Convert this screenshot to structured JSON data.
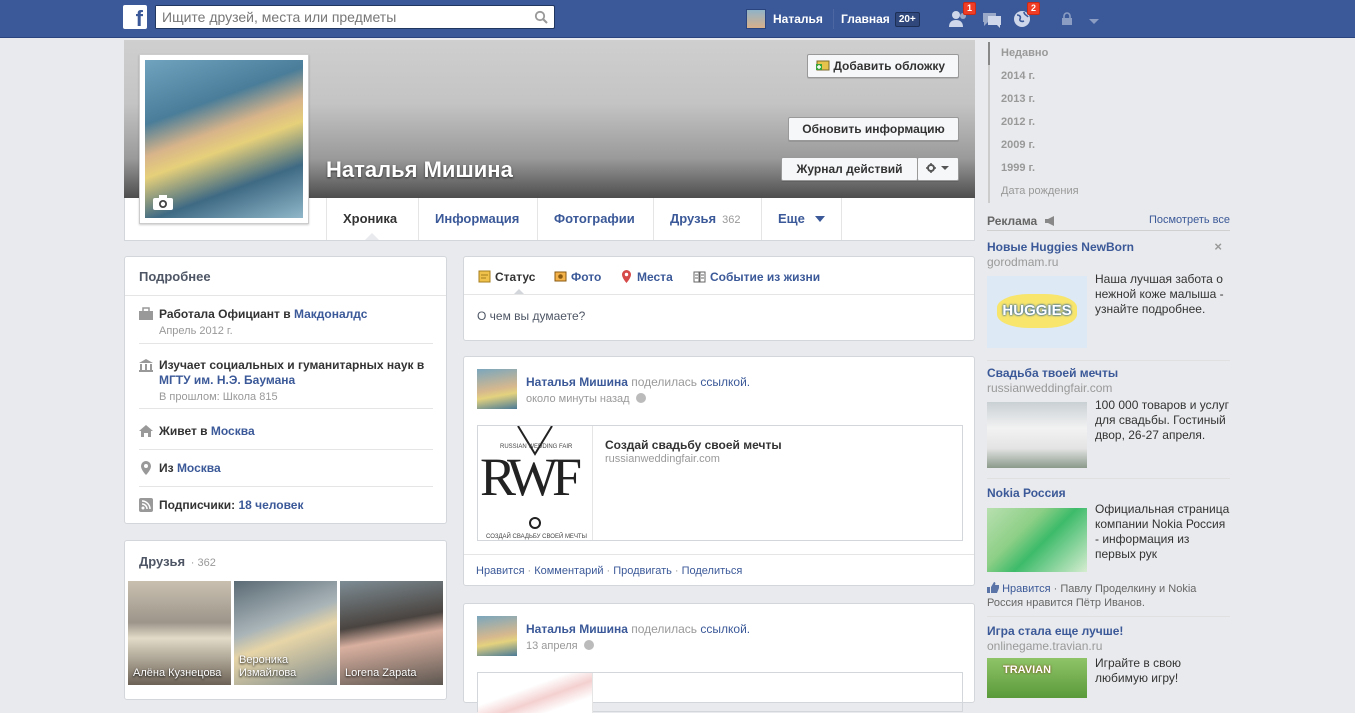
{
  "topbar": {
    "search_placeholder": "Ищите друзей, места или предметы",
    "user_name": "Наталья",
    "home_label": "Главная",
    "home_count": "20+",
    "friend_requests_badge": "1",
    "notifications_badge": "2"
  },
  "cover": {
    "add_cover_label": "Добавить обложку",
    "update_info_label": "Обновить информацию",
    "activity_log_label": "Журнал действий",
    "profile_name": "Наталья Мишина"
  },
  "tabs": [
    {
      "label": "Хроника"
    },
    {
      "label": "Информация"
    },
    {
      "label": "Фотографии"
    },
    {
      "label": "Друзья",
      "count": "362"
    },
    {
      "label": "Еще"
    }
  ],
  "about": {
    "title": "Подробнее",
    "work_prefix": "Работала Официант в ",
    "work_place": "Макдоналдс",
    "work_date": "Апрель 2012 г.",
    "study_prefix": "Изучает социальных и гуманитарных наук в ",
    "study_place": "МГТУ им. Н.Э. Баумана",
    "study_past": "В прошлом: Школа 815",
    "lives_prefix": "Живет в ",
    "lives_city": "Москва",
    "from_prefix": "Из ",
    "from_city": "Москва",
    "followers_prefix": "Подписчики: ",
    "followers_count": "18 человек"
  },
  "friends_box": {
    "title": "Друзья",
    "count": "· 362",
    "list": [
      {
        "name": "Алёна Кузнецова"
      },
      {
        "name": "Вероника Измайлова"
      },
      {
        "name": "Lorena Zapata"
      }
    ]
  },
  "composer": {
    "tabs": [
      "Статус",
      "Фото",
      "Места",
      "Событие из жизни"
    ],
    "placeholder": "О чем вы думаете?"
  },
  "posts": [
    {
      "author": "Наталья Мишина",
      "verb": " поделилась ",
      "object": "ссылкой.",
      "time": "около минуты назад",
      "link_title": "Создай свадьбу своей мечты",
      "link_url": "russianweddingfair.com",
      "logo_text": "RWF",
      "logo_top": "RUSSIAN WEDDING FAIR",
      "logo_bottom": "СОЗДАЙ СВАДЬБУ СВОЕЙ МЕЧТЫ",
      "actions": [
        "Нравится",
        "Комментарий",
        "Продвигать",
        "Поделиться"
      ]
    },
    {
      "author": "Наталья Мишина",
      "verb": " поделилась ",
      "object": "ссылкой.",
      "time": "13 апреля"
    }
  ],
  "timeline_years": [
    "Недавно",
    "2014 г.",
    "2013 г.",
    "2012 г.",
    "2009 г.",
    "1999 г.",
    "Дата рождения"
  ],
  "ads": {
    "header": "Реклама",
    "see_all": "Посмотреть все",
    "items": [
      {
        "title": "Новые Huggies NewBorn",
        "url": "gorodmam.ru",
        "text": "Наша лучшая забота о нежной коже малыша - узнайте подробнее.",
        "logo": "HUGGIES"
      },
      {
        "title": "Свадьба твоей мечты",
        "url": "russianweddingfair.com",
        "text": "100 000 товаров и услуг для свадьбы. Гостиный двор, 26-27 апреля."
      },
      {
        "title": "Nokia Россия",
        "url": "",
        "text": "Официальная страница компании Nokia Россия - информация из первых рук",
        "like_label": "Нравится",
        "social": " · Павлу Проделкину и Nokia Россия нравится Пётр Иванов."
      },
      {
        "title": "Игра стала еще лучше!",
        "url": "onlinegame.travian.ru",
        "text": "Играйте в свою любимую игру!",
        "logo": "TRAVIAN"
      }
    ]
  },
  "colors": {
    "brand": "#3b5998",
    "badge": "#f03d25"
  }
}
